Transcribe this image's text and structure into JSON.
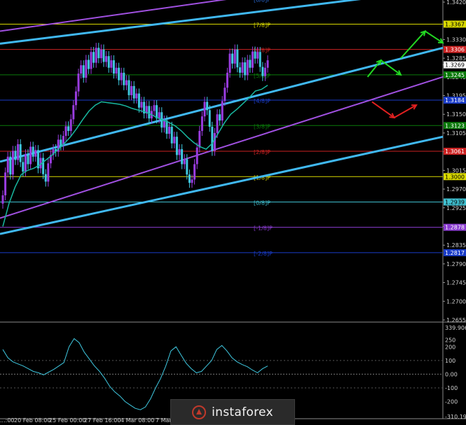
{
  "chart_data": [
    {
      "type": "candlestick",
      "panel": "price",
      "price_scale": {
        "min": 1.2655,
        "max": 1.342,
        "ticks": [
          "1.3420",
          "1.3330",
          "1.3285",
          "1.3269",
          "1.3240",
          "1.3195",
          "1.3150",
          "1.3105",
          "1.3060",
          "1.3015",
          "1.2970",
          "1.2925",
          "1.2880",
          "1.2835",
          "1.2790",
          "1.2745",
          "1.2700",
          "1.2655"
        ]
      },
      "time_labels": [
        "...:00",
        "20 Feb 08:00",
        "25 Feb 00:00",
        "27 Feb 16:00",
        "4 Mar 08:00",
        "7 Mar ..."
      ],
      "last_price": "1.3269",
      "murray_levels": [
        {
          "label": "[8/8]P",
          "value": 1.3428,
          "color": "#2a6bd6"
        },
        {
          "label": "[7/8]P",
          "value": 1.3367,
          "color": "#d8d800"
        },
        {
          "label": "[6/8]P",
          "value": 1.3306,
          "color": "#cc2222"
        },
        {
          "label": "[5/8]P",
          "value": 1.3245,
          "color": "#0a7a0a"
        },
        {
          "label": "[4/8]P",
          "value": 1.3184,
          "color": "#1a3cc8"
        },
        {
          "label": "[3/8]P",
          "value": 1.3123,
          "color": "#0a7a0a"
        },
        {
          "label": "[2/8]P",
          "value": 1.3061,
          "color": "#cc2222"
        },
        {
          "label": "[1/8]P",
          "value": 1.3,
          "color": "#d8d800"
        },
        {
          "label": "[0/8]P",
          "value": 1.2939,
          "color": "#40c0d0"
        },
        {
          "label": "[-1/8]P",
          "value": 1.2878,
          "color": "#8a3cd0"
        },
        {
          "label": "[-2/8]P",
          "value": 1.2817,
          "color": "#1a3cc8"
        }
      ],
      "price_tags": [
        {
          "text": "1.3367",
          "value": 1.3367,
          "bg": "#d8d800",
          "fg": "#000000"
        },
        {
          "text": "1.3306",
          "value": 1.3306,
          "bg": "#cc2222",
          "fg": "#ffffff"
        },
        {
          "text": "1.3245",
          "value": 1.3245,
          "bg": "#0a7a0a",
          "fg": "#ffffff"
        },
        {
          "text": "1.3184",
          "value": 1.3184,
          "bg": "#1a3cc8",
          "fg": "#ffffff"
        },
        {
          "text": "1.3123",
          "value": 1.3123,
          "bg": "#0a7a0a",
          "fg": "#ffffff"
        },
        {
          "text": "1.3061",
          "value": 1.3061,
          "bg": "#cc2222",
          "fg": "#ffffff"
        },
        {
          "text": "1.3000",
          "value": 1.3,
          "bg": "#d8d800",
          "fg": "#000000"
        },
        {
          "text": "1.2939",
          "value": 1.2939,
          "bg": "#40c0d0",
          "fg": "#000000"
        },
        {
          "text": "1.2878",
          "value": 1.2878,
          "bg": "#8a3cd0",
          "fg": "#ffffff"
        },
        {
          "text": "1.2817",
          "value": 1.2817,
          "bg": "#1a3cc8",
          "fg": "#ffffff"
        }
      ],
      "candle_closes": [
        1.2955,
        1.301,
        1.3048,
        1.3005,
        1.3062,
        1.304,
        1.3078,
        1.3035,
        1.3012,
        1.3054,
        1.303,
        1.3072,
        1.3048,
        1.3064,
        1.302,
        1.3045,
        1.3006,
        1.2988,
        1.3032,
        1.3052,
        1.3066,
        1.306,
        1.3089,
        1.3075,
        1.3098,
        1.3121,
        1.311,
        1.3138,
        1.3172,
        1.3205,
        1.3248,
        1.3268,
        1.3238,
        1.3281,
        1.3259,
        1.33,
        1.3274,
        1.331,
        1.3285,
        1.3306,
        1.3276,
        1.329,
        1.3262,
        1.328,
        1.3248,
        1.3262,
        1.3232,
        1.325,
        1.322,
        1.3232,
        1.3196,
        1.3218,
        1.3188,
        1.32,
        1.3166,
        1.318,
        1.3152,
        1.317,
        1.314,
        1.3158,
        1.3172,
        1.314,
        1.3155,
        1.3118,
        1.3135,
        1.3103,
        1.312,
        1.308,
        1.3096,
        1.3052,
        1.3066,
        1.303,
        1.3042,
        1.3005,
        1.2985,
        1.2993,
        1.303,
        1.307,
        1.311,
        1.3145,
        1.318,
        1.316,
        1.312,
        1.3062,
        1.3105,
        1.315,
        1.3135,
        1.3182,
        1.3214,
        1.325,
        1.3296,
        1.3272,
        1.3306,
        1.3263,
        1.325,
        1.3275,
        1.3244,
        1.3281,
        1.3262,
        1.3301,
        1.3284,
        1.33,
        1.3264,
        1.3242,
        1.3262,
        1.328
      ],
      "regression_channel": {
        "outer_lines": [
          [
            1.3036,
            1.331
          ],
          [
            1.2862,
            1.3096
          ]
        ],
        "center_line": [
          1.29,
          1.324
        ],
        "inner_upper": [
          1.332,
          1.3452
        ],
        "extra_upper": [
          1.335,
          1.35
        ]
      },
      "moving_average": [
        1.288,
        1.2935,
        1.2975,
        1.3005,
        1.3015,
        1.302,
        1.3028,
        1.304,
        1.3052,
        1.3066,
        1.308,
        1.3096,
        1.3116,
        1.3138,
        1.3158,
        1.3172,
        1.318,
        1.3178,
        1.3176,
        1.3174,
        1.317,
        1.3164,
        1.316,
        1.3156,
        1.315,
        1.3142,
        1.3136,
        1.313,
        1.3122,
        1.311,
        1.3095,
        1.3082,
        1.3072,
        1.3066,
        1.308,
        1.3105,
        1.313,
        1.315,
        1.3162,
        1.3176,
        1.319,
        1.3206,
        1.321,
        1.322
      ],
      "arrows": [
        {
          "color": "#23d823",
          "from": [
            0.83,
            1.324
          ],
          "to": [
            0.86,
            1.328
          ]
        },
        {
          "color": "#23d823",
          "from": [
            0.86,
            1.328
          ],
          "to": [
            0.905,
            1.3245
          ]
        },
        {
          "color": "#23d823",
          "from": [
            0.905,
            1.3285
          ],
          "to": [
            0.96,
            1.335
          ]
        },
        {
          "color": "#23d823",
          "from": [
            0.96,
            1.335
          ],
          "to": [
            1.0,
            1.3322
          ]
        },
        {
          "color": "#e02020",
          "from": [
            0.84,
            1.318
          ],
          "to": [
            0.89,
            1.3142
          ]
        },
        {
          "color": "#e02020",
          "from": [
            0.89,
            1.3142
          ],
          "to": [
            0.94,
            1.3172
          ]
        }
      ]
    },
    {
      "type": "line",
      "panel": "oscillator",
      "ticks": [
        "339.9066",
        "250",
        "200",
        "100",
        "0.00",
        "-100",
        "-200",
        "-310.194"
      ],
      "ylim": [
        -310.194,
        339.9066
      ],
      "values": [
        180,
        120,
        90,
        75,
        60,
        40,
        20,
        10,
        -5,
        15,
        35,
        60,
        85,
        200,
        260,
        230,
        160,
        110,
        60,
        20,
        -30,
        -90,
        -130,
        -160,
        -200,
        -225,
        -250,
        -260,
        -240,
        -180,
        -100,
        -30,
        60,
        170,
        200,
        140,
        80,
        40,
        10,
        20,
        60,
        100,
        180,
        210,
        170,
        120,
        90,
        70,
        55,
        30,
        10,
        40,
        60
      ]
    }
  ],
  "watermark": {
    "text": "instaforex"
  }
}
